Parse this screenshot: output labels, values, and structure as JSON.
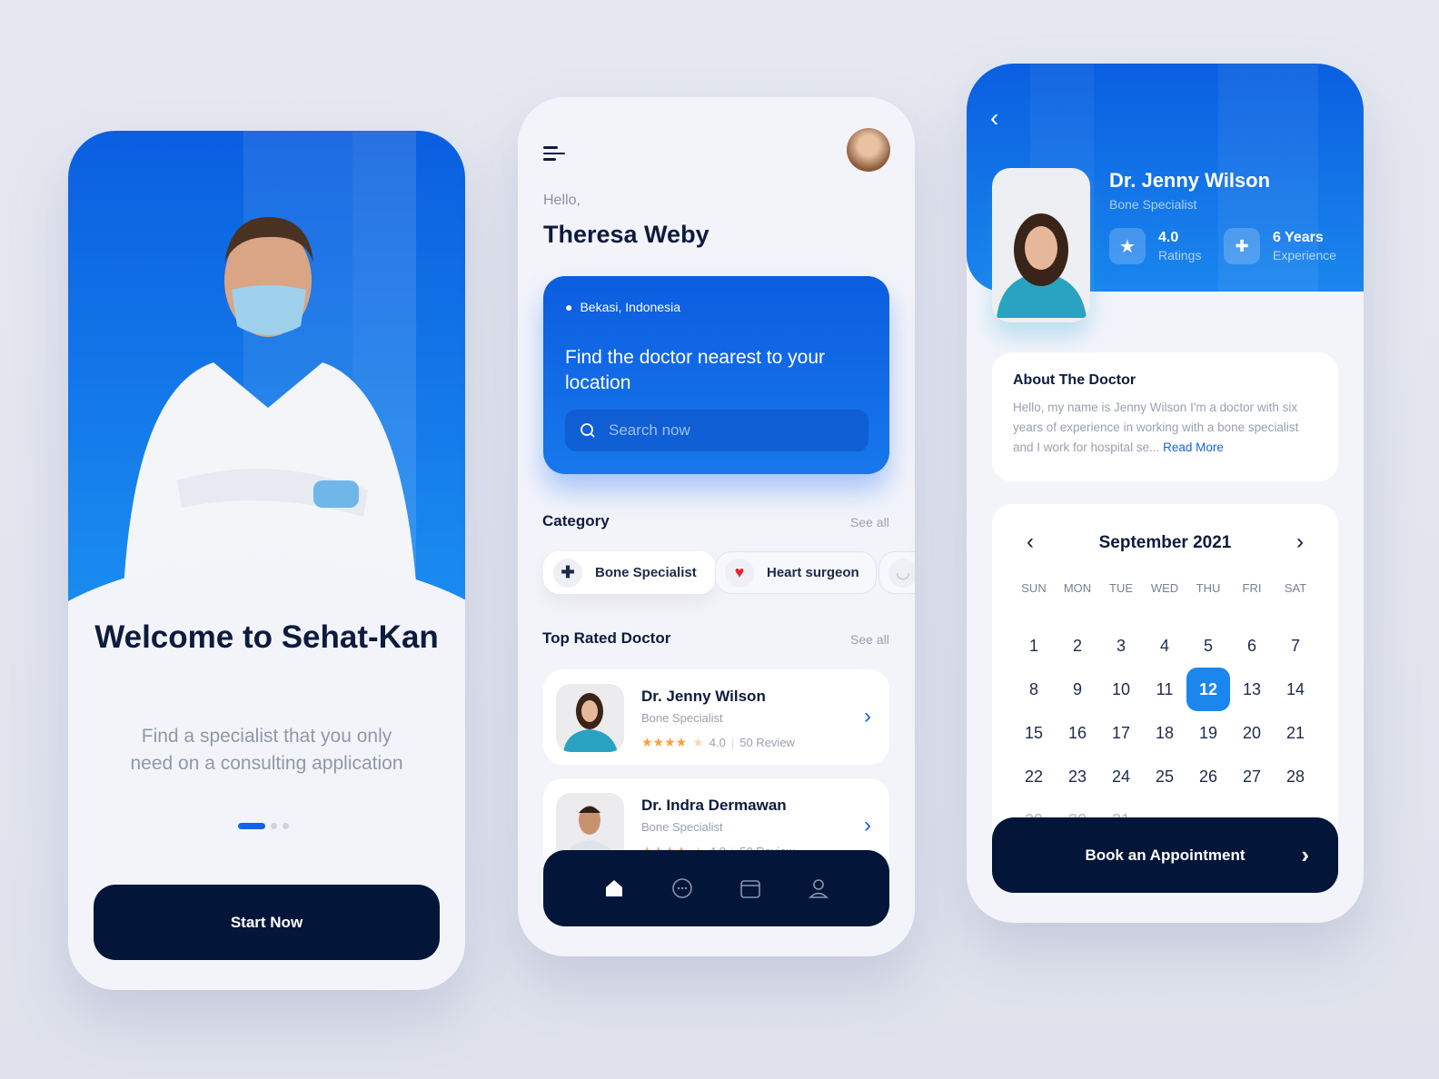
{
  "onboarding": {
    "title": "Welcome to Sehat-Kan",
    "subtitle": "Find a specialist that you only need on a consulting application",
    "page_indicator": {
      "current": 1,
      "total": 3
    },
    "start_button": "Start Now"
  },
  "home": {
    "greeting": "Hello,",
    "user_name": "Theresa Weby",
    "location": "Bekasi, Indonesia",
    "card_title": "Find the doctor nearest to your location",
    "search_placeholder": "Search now",
    "category_title": "Category",
    "category_see_all": "See all",
    "categories": [
      {
        "label": "Bone Specialist",
        "icon": "bone-icon"
      },
      {
        "label": "Heart surgeon",
        "icon": "heart-icon"
      },
      {
        "label": "",
        "icon": "tooth-icon"
      }
    ],
    "top_rated_title": "Top Rated Doctor",
    "top_rated_see_all": "See all",
    "doctors": [
      {
        "name": "Dr. Jenny Wilson",
        "specialty": "Bone Specialist",
        "rating": "4.0",
        "reviews": "50 Review",
        "stars": 4
      },
      {
        "name": "Dr. Indra Dermawan",
        "specialty": "Bone Specialist",
        "rating": "4.0",
        "reviews": "50 Review",
        "stars": 4
      }
    ],
    "nav": [
      "home-icon",
      "chat-icon",
      "calendar-icon",
      "profile-icon"
    ],
    "active_nav": "home-icon"
  },
  "detail": {
    "name": "Dr. Jenny Wilson",
    "specialty": "Bone Specialist",
    "rating_value": "4.0",
    "rating_label": "Ratings",
    "experience_value": "6 Years",
    "experience_label": "Experience",
    "about_title": "About The Doctor",
    "about_text": "Hello, my name is Jenny Wilson I'm a doctor with six years of experience in working with a bone specialist and I work for hospital se...",
    "read_more": "Read More",
    "calendar": {
      "month": "September 2021",
      "weekdays": [
        "SUN",
        "MON",
        "TUE",
        "WED",
        "THU",
        "FRI",
        "SAT"
      ],
      "days": [
        1,
        2,
        3,
        4,
        5,
        6,
        7,
        8,
        9,
        10,
        11,
        12,
        13,
        14,
        15,
        16,
        17,
        18,
        19,
        20,
        21,
        22,
        23,
        24,
        25,
        26,
        27,
        28,
        29,
        30,
        31
      ],
      "selected": 12
    },
    "book_button": "Book an Appointment"
  },
  "colors": {
    "primary": "#1463e6",
    "dark": "#03163a",
    "star": "#f7a23b"
  }
}
